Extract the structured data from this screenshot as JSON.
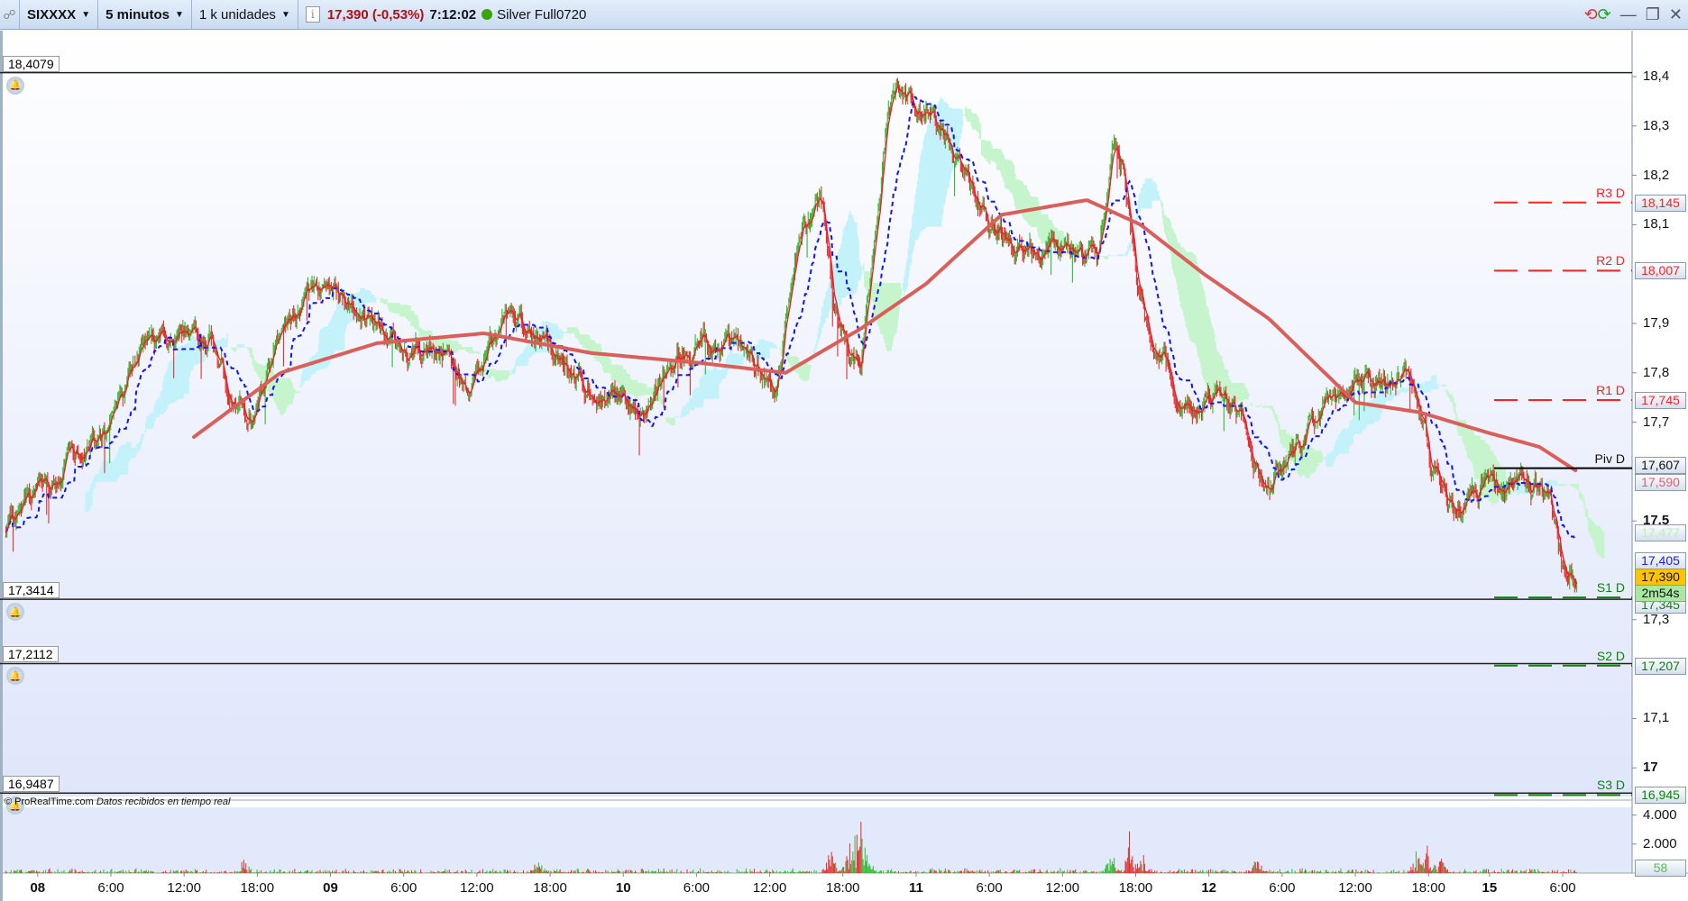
{
  "toolbar": {
    "symbol": "SIXXXX",
    "timeframe": "5 minutos",
    "units": "1 k unidades",
    "last_price": "17,390 (-0,53%)",
    "time": "7:12:02",
    "account": "Silver Full0720"
  },
  "footer": {
    "copyright": "© ProRealTime.com",
    "realtime": "Datos recibidos en tiempo real"
  },
  "alerts": [
    "18,4079",
    "17,3414",
    "17,2112",
    "16,9487"
  ],
  "colors": {
    "up": "#33b833",
    "down": "#e03030",
    "price_line": "#ee1c24",
    "kijun": "#1515ee",
    "ma": "#d9605a",
    "cloud_up": "#c4f2fa",
    "cloud_down": "#c6f4cc",
    "resistance": "#ff2020",
    "support": "#108010"
  },
  "chart_data": {
    "type": "line",
    "title": "SIXXXX 5 minutos",
    "x_unit": "hours from 08 00:00 (trading axis)",
    "xlim": [
      -2.6,
      130.7
    ],
    "ylim": [
      16.94,
      18.47
    ],
    "x_ticks": [
      {
        "h": 0,
        "label": "08",
        "bold": true
      },
      {
        "h": 6,
        "label": "6:00"
      },
      {
        "h": 12,
        "label": "12:00"
      },
      {
        "h": 18,
        "label": "18:00"
      },
      {
        "h": 24,
        "label": "09",
        "bold": true
      },
      {
        "h": 30,
        "label": "6:00"
      },
      {
        "h": 36,
        "label": "12:00"
      },
      {
        "h": 42,
        "label": "18:00"
      },
      {
        "h": 48,
        "label": "10",
        "bold": true
      },
      {
        "h": 54,
        "label": "6:00"
      },
      {
        "h": 60,
        "label": "12:00"
      },
      {
        "h": 66,
        "label": "18:00"
      },
      {
        "h": 72,
        "label": "11",
        "bold": true
      },
      {
        "h": 78,
        "label": "6:00"
      },
      {
        "h": 84,
        "label": "12:00"
      },
      {
        "h": 90,
        "label": "18:00"
      },
      {
        "h": 96,
        "label": "12",
        "bold": true
      },
      {
        "h": 102,
        "label": "6:00"
      },
      {
        "h": 108,
        "label": "12:00"
      },
      {
        "h": 114,
        "label": "18:00"
      },
      {
        "h": 119,
        "label": "15",
        "bold": true
      },
      {
        "h": 125,
        "label": "6:00"
      }
    ],
    "y_ticks": [
      {
        "v": 18.4,
        "label": "18,4"
      },
      {
        "v": 18.3,
        "label": "18,3"
      },
      {
        "v": 18.2,
        "label": "18,2"
      },
      {
        "v": 18.1,
        "label": "18,1"
      },
      {
        "v": 17.9,
        "label": "17,9"
      },
      {
        "v": 17.8,
        "label": "17,8"
      },
      {
        "v": 17.7,
        "label": "17,7"
      },
      {
        "v": 17.5,
        "label": "17.5",
        "bold": true
      },
      {
        "v": 17.3,
        "label": "17,3"
      },
      {
        "v": 17.1,
        "label": "17,1"
      },
      {
        "v": 17.0,
        "label": "17",
        "bold": true
      }
    ],
    "price_keypoints": [
      [
        -2.6,
        17.49
      ],
      [
        2.2,
        17.62
      ],
      [
        5.7,
        17.67
      ],
      [
        8.4,
        17.84
      ],
      [
        12.4,
        17.89
      ],
      [
        14.6,
        17.86
      ],
      [
        16,
        17.74
      ],
      [
        17.6,
        17.72
      ],
      [
        19.9,
        17.9
      ],
      [
        22.1,
        17.96
      ],
      [
        25.1,
        17.96
      ],
      [
        27.8,
        17.9
      ],
      [
        30.4,
        17.83
      ],
      [
        33.1,
        17.85
      ],
      [
        35.3,
        17.78
      ],
      [
        38.8,
        17.92
      ],
      [
        41.9,
        17.86
      ],
      [
        45.4,
        17.76
      ],
      [
        49.9,
        17.74
      ],
      [
        52.5,
        17.85
      ],
      [
        56.9,
        17.86
      ],
      [
        60.4,
        17.77
      ],
      [
        62.6,
        18.09
      ],
      [
        64.4,
        18.14
      ],
      [
        65.3,
        17.94
      ],
      [
        67.5,
        17.79
      ],
      [
        68.8,
        18.12
      ],
      [
        70.1,
        18.38
      ],
      [
        72.8,
        18.34
      ],
      [
        74.6,
        18.27
      ],
      [
        76.8,
        18.15
      ],
      [
        79.9,
        18.06
      ],
      [
        81.6,
        18.05
      ],
      [
        85.2,
        18.05
      ],
      [
        86.9,
        18.03
      ],
      [
        88.2,
        18.27
      ],
      [
        89.1,
        18.2
      ],
      [
        90.4,
        17.94
      ],
      [
        91.8,
        17.84
      ],
      [
        94,
        17.73
      ],
      [
        96.6,
        17.76
      ],
      [
        99.3,
        17.68
      ],
      [
        100.1,
        17.57
      ],
      [
        102.8,
        17.64
      ],
      [
        105.5,
        17.74
      ],
      [
        108.1,
        17.78
      ],
      [
        111.6,
        17.78
      ],
      [
        112.5,
        17.81
      ],
      [
        114.3,
        17.6
      ],
      [
        116,
        17.51
      ],
      [
        118.7,
        17.58
      ],
      [
        122.2,
        17.58
      ],
      [
        124,
        17.55
      ],
      [
        124.9,
        17.42
      ],
      [
        126.2,
        17.39
      ]
    ],
    "ma_keypoints": [
      [
        12.8,
        17.67
      ],
      [
        19.9,
        17.8
      ],
      [
        27.8,
        17.86
      ],
      [
        36.6,
        17.88
      ],
      [
        45.4,
        17.84
      ],
      [
        54.3,
        17.82
      ],
      [
        61.3,
        17.8
      ],
      [
        67.5,
        17.89
      ],
      [
        72.8,
        17.98
      ],
      [
        79,
        18.12
      ],
      [
        86,
        18.15
      ],
      [
        90.4,
        18.1
      ],
      [
        95.6,
        18.0
      ],
      [
        100.9,
        17.91
      ],
      [
        108,
        17.74
      ],
      [
        113.3,
        17.72
      ],
      [
        118.7,
        17.68
      ],
      [
        123.1,
        17.65
      ],
      [
        126.2,
        17.6
      ]
    ],
    "alert_levels": [
      18.4079,
      17.3414,
      17.2112,
      16.9487
    ],
    "pivot_levels": [
      {
        "name": "R3 D",
        "value": 18.145,
        "label": "18,145",
        "kind": "resistance"
      },
      {
        "name": "R2 D",
        "value": 18.007,
        "label": "18,007",
        "kind": "resistance"
      },
      {
        "name": "R1 D",
        "value": 17.745,
        "label": "17,745",
        "kind": "resistance"
      },
      {
        "name": "Piv D",
        "value": 17.607,
        "label": "17,607",
        "kind": "pivot"
      },
      {
        "name": "S1 D",
        "value": 17.345,
        "label": "17,345",
        "kind": "support"
      },
      {
        "name": "S2 D",
        "value": 17.207,
        "label": "17,207",
        "kind": "support"
      },
      {
        "name": "S3 D",
        "value": 16.945,
        "label": "16,945",
        "kind": "support"
      }
    ],
    "indicator_values": [
      {
        "label": "17,590",
        "value": 17.59,
        "color": "#e06070"
      },
      {
        "label": "17,477",
        "value": 17.477,
        "color": "#b8f0b8"
      },
      {
        "label": "17,405",
        "value": 17.405,
        "color": "#2020e0"
      }
    ],
    "current_price": {
      "label": "17,390",
      "value": 17.39
    },
    "countdown": "2m54s",
    "volume": {
      "ylim": [
        0,
        4700
      ],
      "y_ticks": [
        {
          "v": 4000,
          "label": "4.000"
        },
        {
          "v": 2000,
          "label": "2.000"
        }
      ],
      "current": "58",
      "peaks": [
        [
          17,
          900
        ],
        [
          41,
          700
        ],
        [
          65,
          1500
        ],
        [
          66.5,
          2000
        ],
        [
          67.3,
          4300
        ],
        [
          68,
          1800
        ],
        [
          88,
          1800
        ],
        [
          89.5,
          2800
        ],
        [
          90.5,
          1600
        ],
        [
          100,
          900
        ],
        [
          113,
          1500
        ],
        [
          114,
          2000
        ],
        [
          115,
          1200
        ]
      ]
    }
  }
}
